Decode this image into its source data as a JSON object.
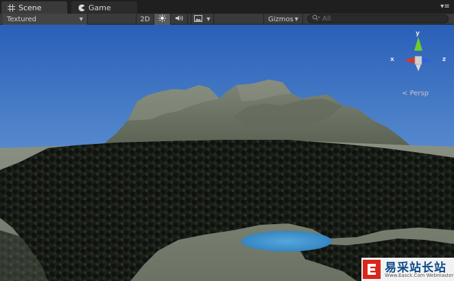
{
  "window": {
    "tabs": [
      {
        "label": "Scene",
        "icon": "grid-icon",
        "active": true
      },
      {
        "label": "Game",
        "icon": "pacman-icon",
        "active": false
      }
    ]
  },
  "toolbar": {
    "render_mode": "Textured",
    "mode_2d_label": "2D",
    "gizmos_label": "Gizmos",
    "search_placeholder": "All"
  },
  "gizmo": {
    "x_label": "x",
    "y_label": "y",
    "z_label": "z",
    "projection_label": "Persp"
  },
  "watermark": {
    "title": "易采站长站",
    "subtitle": "Www.Easck.Com Webmaster"
  },
  "colors": {
    "sky_top": "#2a5fb8",
    "sky_horizon": "#9cc4e4",
    "terrain": "#6e7466",
    "trees": "#141814",
    "water": "#3f8fc9",
    "axis_x": "#d23a2e",
    "axis_y": "#6ccd2c",
    "axis_z": "#2c62d8"
  }
}
